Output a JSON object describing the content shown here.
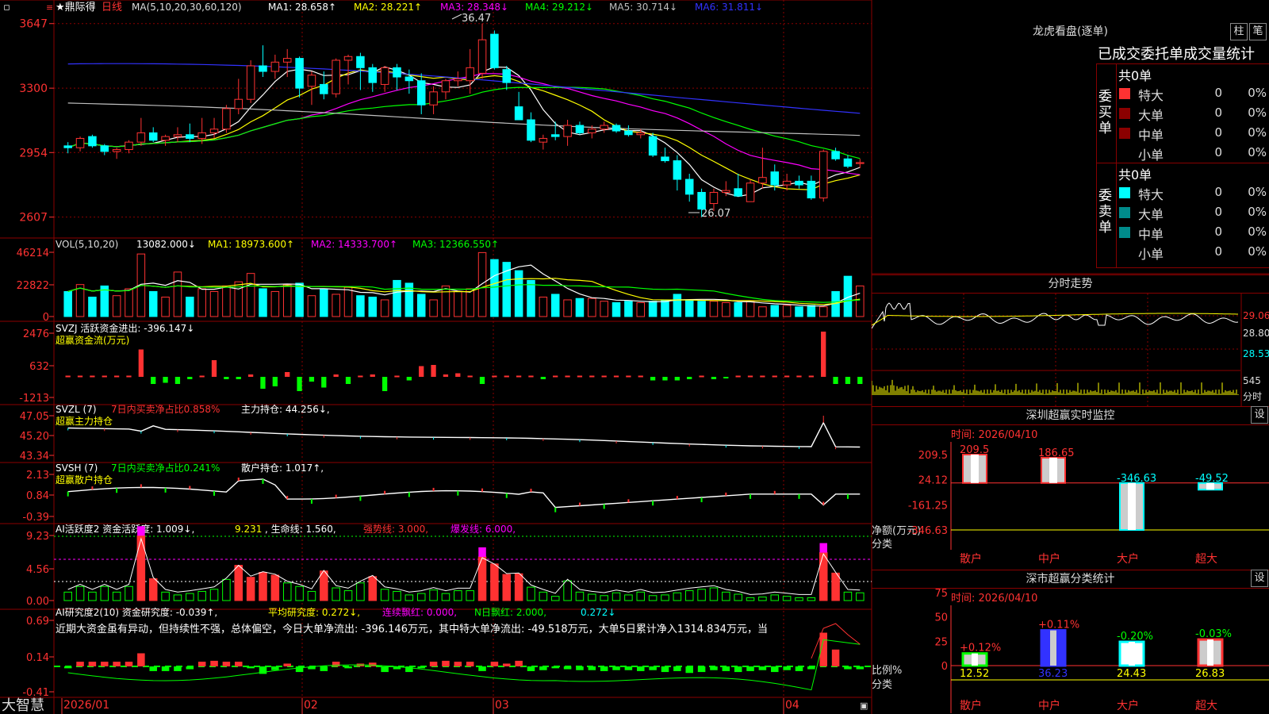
{
  "stock": {
    "name": "★鼎际得",
    "period": "日线"
  },
  "colors": {
    "up": "#ff3232",
    "down": "#00ffff",
    "grid": "#800000",
    "green": "#00ff00",
    "yellow": "#ffff00",
    "magenta": "#ff00ff",
    "blue": "#3232ff",
    "white": "#ffffff"
  },
  "main": {
    "ma_header": {
      "label": "MA(5,10,20,30,60,120)",
      "ma1": "MA1: 28.658↑",
      "ma2": "MA2: 28.221↑",
      "ma3": "MA3: 28.348↓",
      "ma4": "MA4: 29.212↓",
      "ma5": "MA5: 30.714↓",
      "ma6": "MA6: 31.811↓"
    },
    "yticks": [
      "3647",
      "3300",
      "2954",
      "2607"
    ],
    "high_label": "36.47",
    "low_label": "26.07"
  },
  "vol": {
    "label": "VOL(5,10,20)",
    "v": "13082.000↓",
    "ma1": "MA1: 18973.600↑",
    "ma2": "MA2: 14333.700↑",
    "ma3": "MA3: 12366.550↑",
    "yticks": [
      "46214",
      "22822",
      "0"
    ]
  },
  "svzj": {
    "label": "SVZJ  活跃资金进出: -396.147↓",
    "sub": "超赢资金流(万元)",
    "yticks": [
      "2476",
      "632",
      "-1213"
    ]
  },
  "svzl": {
    "label": "SVZL (7) ",
    "red": "7日内买卖净占比0.858%",
    "rest": " 主力持仓: 44.256↓,",
    "sub": "超赢主力持仓",
    "yticks": [
      "47.05",
      "45.20",
      "43.34"
    ]
  },
  "svsh": {
    "label": "SVSH (7) ",
    "red": "7日内买卖净占比0.241%",
    "rest": " 散户持仓: 1.017↑,",
    "sub": "超赢散户持仓",
    "yticks": [
      "2.13",
      "0.84",
      "-0.39"
    ]
  },
  "ai1": {
    "label": "AI活跃度2 资金活跃度: 1.009↓, ",
    "v2": "9.231",
    "v3": ", 生命线: 1.560, ",
    "v4": "强势线: 3.000, ",
    "v5": "爆发线: 6.000,",
    "yticks": [
      "9.23",
      "4.56",
      "0.00"
    ]
  },
  "ai2": {
    "label": "AI研究度2(10) 资金研究度: -0.039↑, ",
    "v2": "平均研究度: 0.272↓, ",
    "v3": "连续飘红: 0.000, ",
    "v4": "N日飘红: 2.000, ",
    "v5": "0.272↓",
    "text": "近期大资金虽有异动，但持续性不强，总体偏空，今日大单净流出: -396.146万元，其中特大单净流出: -49.518万元，大单5日累计净入1314.834万元，当",
    "yticks": [
      "0.69",
      "0.14",
      "-0.41"
    ]
  },
  "xaxis": {
    "brand": "大智慧",
    "labels": [
      "2026/01",
      "02",
      "03",
      "04"
    ]
  },
  "lhb": {
    "title": "龙虎看盘(逐单)",
    "btn_zhu": "柱",
    "btn_bi": "笔",
    "table_title": "已成交委托单成交量统计",
    "buy": {
      "side": "委买单",
      "total": "共0单",
      "rows": [
        {
          "name": "特大",
          "count": "0",
          "pct": "0%"
        },
        {
          "name": "大单",
          "count": "0",
          "pct": "0%"
        },
        {
          "name": "中单",
          "count": "0",
          "pct": "0%"
        },
        {
          "name": "小单",
          "count": "0",
          "pct": "0%"
        }
      ]
    },
    "sell": {
      "side": "委卖单",
      "total": "共0单",
      "rows": [
        {
          "name": "特大",
          "count": "0",
          "pct": "0%"
        },
        {
          "name": "大单",
          "count": "0",
          "pct": "0%"
        },
        {
          "name": "中单",
          "count": "0",
          "pct": "0%"
        },
        {
          "name": "小单",
          "count": "0",
          "pct": "0%"
        }
      ]
    }
  },
  "intraday": {
    "title": "分时走势",
    "price_labels": [
      "29.06",
      "28.80",
      "28.53"
    ],
    "vol_label": "545",
    "vol_unit": "分时"
  },
  "sz_monitor": {
    "title": "深圳超赢实时监控",
    "btn": "设",
    "time": "时间: 2026/04/10",
    "yticks": [
      "209.5",
      "24.12",
      "-161.25",
      "-346.63"
    ],
    "ylabel": "净额(万元)",
    "xlabel": "分类",
    "bars": [
      {
        "cat": "散户",
        "value": 209.5,
        "label": "209.5"
      },
      {
        "cat": "中户",
        "value": 186.65,
        "label": "186.65"
      },
      {
        "cat": "大户",
        "value": -346.63,
        "label": "-346.63"
      },
      {
        "cat": "超大",
        "value": -49.52,
        "label": "-49.52"
      }
    ]
  },
  "sz_class": {
    "title": "深市超赢分类统计",
    "btn": "设",
    "time": "时间: 2026/04/10",
    "yticks": [
      "75",
      "50",
      "25",
      "0"
    ],
    "ylabel": "比例%",
    "xlabel": "分类",
    "bars": [
      {
        "cat": "散户",
        "value": 12.52,
        "label": "12.52",
        "chg": "+0.12%"
      },
      {
        "cat": "中户",
        "value": 36.23,
        "label": "36.23",
        "chg": "+0.11%"
      },
      {
        "cat": "大户",
        "value": 24.43,
        "label": "24.43",
        "chg": "-0.20%"
      },
      {
        "cat": "超大",
        "value": 26.83,
        "label": "26.83",
        "chg": "-0.03%"
      }
    ]
  },
  "chart_data": {
    "type": "candlestick",
    "title": "鼎际得 日线",
    "candles": [
      [
        29.9,
        30.1,
        29.5,
        29.8
      ],
      [
        29.8,
        30.4,
        29.6,
        30.3
      ],
      [
        30.4,
        30.5,
        29.8,
        29.9
      ],
      [
        29.9,
        30.0,
        29.4,
        29.6
      ],
      [
        29.6,
        29.8,
        29.2,
        29.7
      ],
      [
        29.7,
        30.2,
        29.5,
        30.1
      ],
      [
        30.1,
        31.4,
        29.9,
        30.6
      ],
      [
        30.6,
        30.9,
        30.1,
        30.2
      ],
      [
        30.2,
        30.5,
        29.9,
        30.4
      ],
      [
        30.4,
        30.9,
        30.1,
        30.5
      ],
      [
        30.5,
        31.1,
        30.1,
        30.3
      ],
      [
        30.3,
        31.4,
        30.0,
        30.6
      ],
      [
        30.6,
        31.4,
        30.3,
        30.8
      ],
      [
        30.8,
        32.1,
        30.6,
        31.9
      ],
      [
        31.9,
        33.5,
        31.6,
        32.4
      ],
      [
        32.4,
        34.5,
        32.2,
        34.2
      ],
      [
        34.2,
        35.3,
        33.6,
        33.9
      ],
      [
        33.9,
        34.8,
        33.5,
        34.4
      ],
      [
        34.4,
        35.1,
        33.6,
        34.6
      ],
      [
        34.6,
        34.7,
        32.5,
        33.0
      ],
      [
        33.1,
        33.9,
        32.1,
        33.7
      ],
      [
        33.2,
        33.9,
        32.4,
        32.7
      ],
      [
        32.7,
        34.6,
        32.5,
        34.5
      ],
      [
        34.5,
        34.8,
        33.2,
        34.7
      ],
      [
        34.7,
        34.9,
        32.9,
        34.1
      ],
      [
        34.1,
        34.3,
        32.8,
        33.3
      ],
      [
        33.2,
        34.2,
        32.8,
        34.1
      ],
      [
        34.1,
        34.3,
        32.9,
        33.6
      ],
      [
        33.6,
        34.0,
        32.7,
        33.4
      ],
      [
        33.4,
        33.8,
        31.6,
        32.1
      ],
      [
        32.1,
        33.1,
        31.6,
        32.8
      ],
      [
        32.8,
        33.5,
        32.4,
        33.4
      ],
      [
        33.4,
        33.9,
        33.1,
        33.5
      ],
      [
        33.4,
        35.1,
        32.7,
        34.1
      ],
      [
        33.8,
        36.47,
        33.5,
        35.6
      ],
      [
        35.9,
        36.1,
        34.0,
        34.1
      ],
      [
        34.0,
        34.2,
        32.9,
        33.3
      ],
      [
        32.0,
        32.8,
        31.8,
        31.3
      ],
      [
        31.3,
        31.7,
        30.1,
        30.2
      ],
      [
        30.1,
        30.5,
        29.7,
        30.3
      ],
      [
        30.5,
        31.2,
        30.2,
        30.4
      ],
      [
        30.4,
        31.3,
        29.9,
        31.0
      ],
      [
        31.0,
        31.2,
        30.5,
        30.6
      ],
      [
        30.6,
        31.0,
        30.3,
        30.8
      ],
      [
        30.8,
        31.2,
        30.6,
        31.0
      ],
      [
        31.0,
        31.1,
        30.6,
        30.7
      ],
      [
        30.7,
        31.0,
        30.4,
        30.5
      ],
      [
        30.5,
        30.8,
        30.3,
        30.6
      ],
      [
        30.4,
        30.6,
        29.3,
        29.4
      ],
      [
        29.3,
        29.8,
        29.0,
        29.1
      ],
      [
        29.1,
        29.4,
        27.5,
        28.1
      ],
      [
        28.1,
        28.4,
        26.9,
        27.3
      ],
      [
        27.4,
        27.6,
        26.07,
        26.5
      ],
      [
        26.8,
        27.6,
        26.4,
        27.4
      ],
      [
        27.4,
        28.0,
        27.2,
        27.5
      ],
      [
        27.6,
        28.4,
        27.2,
        27.2
      ],
      [
        26.9,
        28.1,
        26.9,
        27.9
      ],
      [
        27.9,
        29.8,
        27.6,
        28.2
      ],
      [
        28.5,
        28.9,
        27.5,
        27.8
      ],
      [
        27.8,
        28.4,
        27.5,
        28.0
      ],
      [
        28.0,
        28.3,
        27.6,
        27.8
      ],
      [
        28.0,
        28.3,
        27.0,
        27.1
      ],
      [
        27.1,
        29.7,
        26.9,
        29.6
      ],
      [
        29.6,
        29.8,
        29.1,
        29.2
      ],
      [
        29.2,
        29.4,
        28.7,
        28.8
      ],
      [
        29.0,
        29.2,
        28.7,
        29.0
      ]
    ],
    "volume": [
      18,
      23,
      14,
      22,
      15,
      20,
      45,
      18,
      14,
      32,
      14,
      20,
      18,
      22,
      25,
      31,
      20,
      18,
      23,
      24,
      15,
      20,
      16,
      21,
      15,
      14,
      12,
      26,
      24,
      16,
      12,
      22,
      18,
      20,
      46,
      41,
      39,
      33,
      26,
      14,
      16,
      12,
      13,
      13,
      11,
      10,
      11,
      10,
      11,
      12,
      16,
      12,
      11,
      11,
      10,
      10,
      11,
      7,
      8,
      8,
      7,
      8,
      7,
      18,
      29,
      22,
      16,
      12
    ],
    "y_range": [
      25.8,
      36.8
    ],
    "vol_range": [
      0,
      46214
    ]
  }
}
